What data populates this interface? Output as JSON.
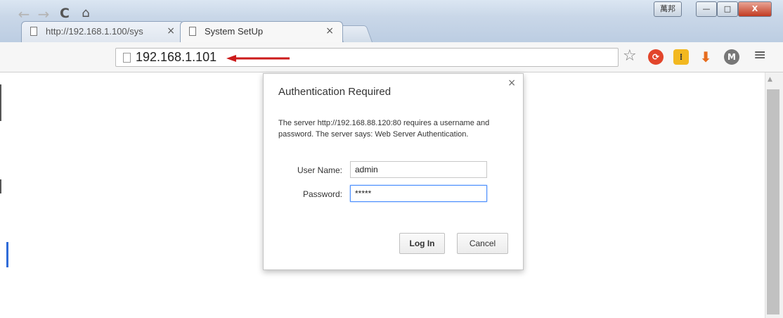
{
  "window": {
    "ime_label": "萬邦",
    "minimize_label": "—",
    "maximize_label": "□",
    "close_label": "X"
  },
  "tabs": [
    {
      "title": "http://192.168.1.100/sys",
      "close": "×"
    },
    {
      "title": "System SetUp",
      "close": "×"
    }
  ],
  "toolbar": {
    "back_icon": "←",
    "forward_icon": "→",
    "reload_icon": "C",
    "home_icon": "⌂",
    "url": "192.168.1.101",
    "star_icon": "☆",
    "menu_icon": "≡",
    "arrow_color": "#cc1b1b"
  },
  "dialog": {
    "title": "Authentication Required",
    "close_icon": "×",
    "message": "The server http://192.168.88.120:80 requires a username and password. The server says: Web Server Authentication.",
    "username_label": "User Name:",
    "username_value": "admin",
    "password_label": "Password:",
    "password_value": "*****",
    "login_label": "Log In",
    "cancel_label": "Cancel"
  }
}
